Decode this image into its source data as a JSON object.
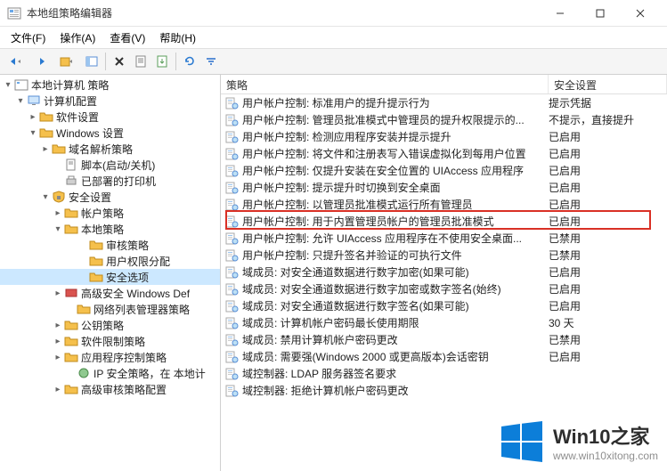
{
  "window": {
    "title": "本地组策略编辑器"
  },
  "menu": {
    "file": "文件(F)",
    "action": "操作(A)",
    "view": "查看(V)",
    "help": "帮助(H)"
  },
  "tree": {
    "root": "本地计算机 策略",
    "computer_config": "计算机配置",
    "software_settings": "软件设置",
    "windows_settings": "Windows 设置",
    "dns_policy": "域名解析策略",
    "scripts": "脚本(启动/关机)",
    "deployed_printers": "已部署的打印机",
    "security_settings": "安全设置",
    "account_policies": "帐户策略",
    "local_policies": "本地策略",
    "audit_policy": "审核策略",
    "user_rights": "用户权限分配",
    "security_options": "安全选项",
    "advanced_windows_def": "高级安全 Windows Def",
    "network_list_mgr": "网络列表管理器策略",
    "public_key_policies": "公钥策略",
    "software_restriction": "软件限制策略",
    "app_control": "应用程序控制策略",
    "ip_security": "IP 安全策略，在 本地计",
    "advanced_audit": "高级审核策略配置"
  },
  "list": {
    "header_policy": "策略",
    "header_setting": "安全设置",
    "rows": [
      {
        "policy": "用户帐户控制: 标准用户的提升提示行为",
        "setting": "提示凭据"
      },
      {
        "policy": "用户帐户控制: 管理员批准模式中管理员的提升权限提示的...",
        "setting": "不提示，直接提升"
      },
      {
        "policy": "用户帐户控制: 检测应用程序安装并提示提升",
        "setting": "已启用"
      },
      {
        "policy": "用户帐户控制: 将文件和注册表写入错误虚拟化到每用户位置",
        "setting": "已启用"
      },
      {
        "policy": "用户帐户控制: 仅提升安装在安全位置的 UIAccess 应用程序",
        "setting": "已启用"
      },
      {
        "policy": "用户帐户控制: 提示提升时切换到安全桌面",
        "setting": "已启用"
      },
      {
        "policy": "用户帐户控制: 以管理员批准模式运行所有管理员",
        "setting": "已启用"
      },
      {
        "policy": "用户帐户控制: 用于内置管理员帐户的管理员批准模式",
        "setting": "已启用"
      },
      {
        "policy": "用户帐户控制: 允许 UIAccess 应用程序在不使用安全桌面...",
        "setting": "已禁用"
      },
      {
        "policy": "用户帐户控制: 只提升签名并验证的可执行文件",
        "setting": "已禁用"
      },
      {
        "policy": "域成员: 对安全通道数据进行数字加密(如果可能)",
        "setting": "已启用"
      },
      {
        "policy": "域成员: 对安全通道数据进行数字加密或数字签名(始终)",
        "setting": "已启用"
      },
      {
        "policy": "域成员: 对安全通道数据进行数字签名(如果可能)",
        "setting": "已启用"
      },
      {
        "policy": "域成员: 计算机帐户密码最长使用期限",
        "setting": "30 天"
      },
      {
        "policy": "域成员: 禁用计算机帐户密码更改",
        "setting": "已禁用"
      },
      {
        "policy": "域成员: 需要强(Windows 2000 或更高版本)会话密钥",
        "setting": "已启用"
      },
      {
        "policy": "域控制器: LDAP 服务器签名要求",
        "setting": ""
      },
      {
        "policy": "域控制器: 拒绝计算机帐户密码更改",
        "setting": ""
      }
    ]
  },
  "highlight_row_index": 6,
  "watermark": {
    "brand": "Win10之家",
    "url": "www.win10xitong.com"
  }
}
